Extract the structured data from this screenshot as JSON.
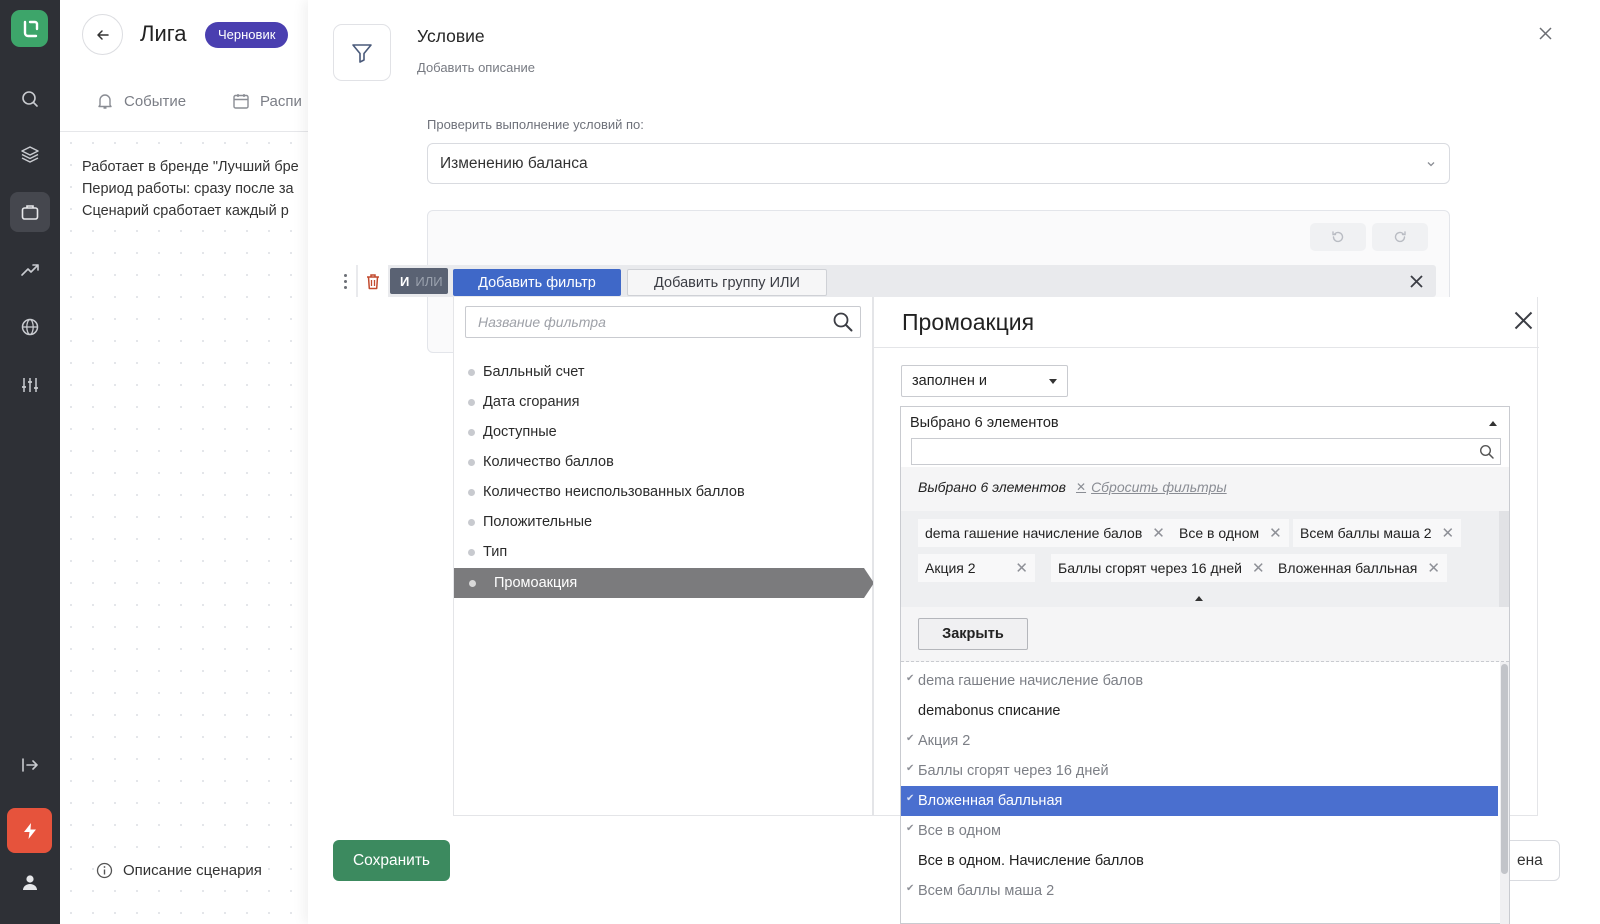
{
  "colors": {
    "rail_bg": "#2e3036",
    "brand_green": "#3da56a",
    "badge_purple": "#4a3fb0",
    "accent_orange": "#e6533c",
    "primary_blue": "#3f68c8",
    "highlight_blue": "#4a6fcf",
    "save_green": "#3c8a5f"
  },
  "sidebar": {
    "icons": [
      "logo-icon",
      "search-icon",
      "layers-icon",
      "briefcase-icon",
      "trending-icon",
      "globe-icon",
      "sliders-icon",
      "logout-icon",
      "bolt-icon",
      "user-icon"
    ]
  },
  "page": {
    "title": "Лига",
    "badge": "Черновик",
    "tabs": [
      {
        "label": "Событие",
        "icon": "bell-icon"
      },
      {
        "label": "Распи",
        "icon": "calendar-icon"
      }
    ],
    "description_lines": [
      "Работает в бренде \"Лучший бре",
      "Период работы: сразу после за",
      "Сценарий сработает каждый р"
    ],
    "scenario_description": "Описание сценария"
  },
  "modal": {
    "title": "Условие",
    "subtitle": "Добавить описание",
    "check_label": "Проверить выполнение условий по:",
    "check_value": "Изменению баланса",
    "save_label": "Сохранить",
    "partial_button": "ена"
  },
  "toolbar": {
    "and_label": "И",
    "or_label": "ИЛИ",
    "add_filter": "Добавить фильтр",
    "add_group": "Добавить группу ИЛИ"
  },
  "filter_list": {
    "search_placeholder": "Название фильтра",
    "items": [
      "Балльный счет",
      "Дата сгорания",
      "Доступные",
      "Количество баллов",
      "Количество неиспользованных баллов",
      "Положительные",
      "Тип",
      "Промоакция"
    ],
    "selected_index": 7
  },
  "promo": {
    "title": "Промоакция",
    "operator": "заполнен и",
    "header": "Выбрано 6 элементов",
    "selected_count": "Выбрано 6 элементов",
    "reset": "Сбросить фильтры",
    "tags": [
      "dema гашение начисление балов",
      "Все в одном",
      "Всем баллы маша 2",
      "Акция 2",
      "Баллы сгорят через 16 дней",
      "Вложенная балльная"
    ],
    "close_label": "Закрыть",
    "options": [
      {
        "label": "dema гашение начисление балов",
        "checked": true
      },
      {
        "label": "demabonus списание",
        "checked": false
      },
      {
        "label": "Акция 2",
        "checked": true
      },
      {
        "label": "Баллы сгорят через 16 дней",
        "checked": true
      },
      {
        "label": "Вложенная балльная",
        "checked": true
      },
      {
        "label": "Все в одном",
        "checked": true
      },
      {
        "label": "Все в одном. Начисление баллов",
        "checked": false
      },
      {
        "label": "Всем баллы маша 2",
        "checked": true
      }
    ],
    "highlighted_option_index": 4
  }
}
